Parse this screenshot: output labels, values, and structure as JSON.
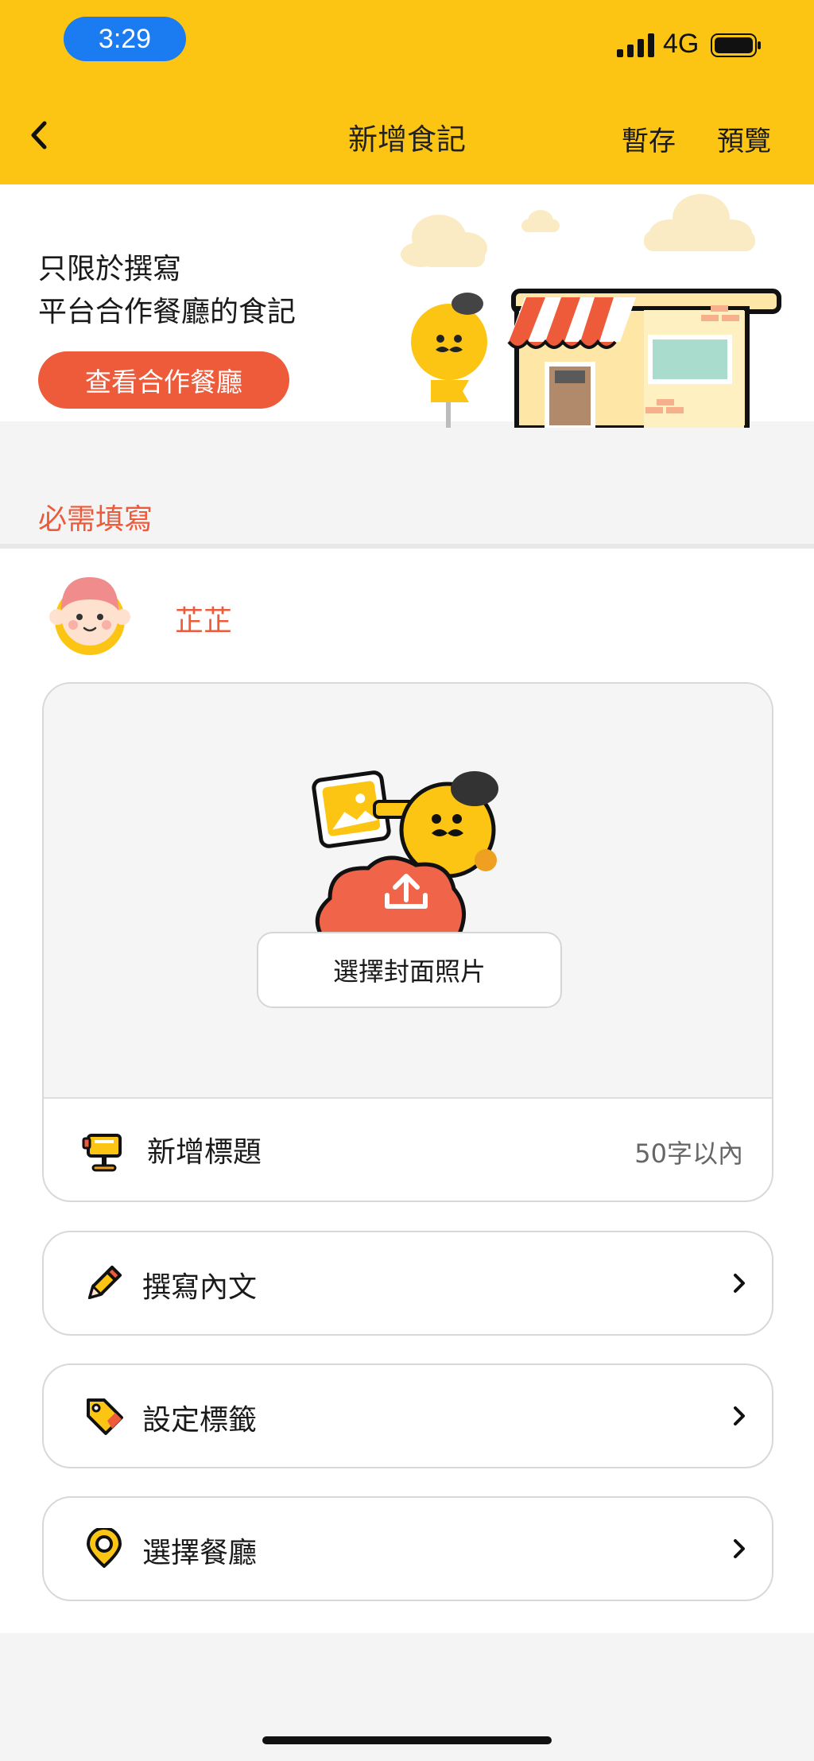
{
  "status_bar": {
    "time": "3:29",
    "network": "4G"
  },
  "nav": {
    "title": "新增食記",
    "save_label": "暫存",
    "preview_label": "預覽"
  },
  "banner": {
    "line1": "只限於撰寫",
    "line2": "平台合作餐廳的食記",
    "button_label": "查看合作餐廳"
  },
  "required_label": "必需填寫",
  "user": {
    "name": "芷芷"
  },
  "cover": {
    "button_label": "選擇封面照片"
  },
  "title_field": {
    "label": "新增標題",
    "limit": "50字以內"
  },
  "rows": [
    {
      "label": "撰寫內文",
      "icon": "pencil-icon"
    },
    {
      "label": "設定標籤",
      "icon": "tag-icon"
    },
    {
      "label": "選擇餐廳",
      "icon": "location-pin-icon"
    }
  ],
  "colors": {
    "brand_yellow": "#fcc514",
    "accent_orange": "#ee5b3b",
    "status_blue": "#1a7cf0"
  }
}
